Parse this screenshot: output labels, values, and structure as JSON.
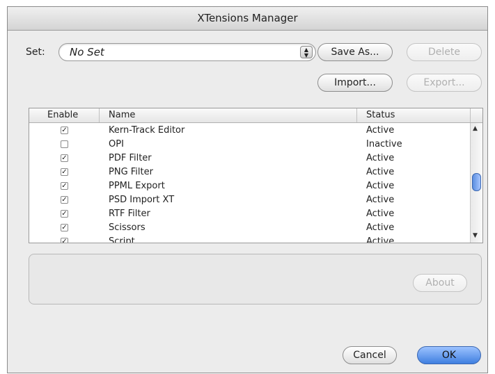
{
  "window": {
    "title": "XTensions Manager"
  },
  "set": {
    "label": "Set:",
    "value": "No Set"
  },
  "buttons": {
    "save_as": "Save As...",
    "delete": "Delete",
    "import": "Import...",
    "export": "Export...",
    "about": "About",
    "cancel": "Cancel",
    "ok": "OK"
  },
  "table": {
    "columns": [
      "Enable",
      "Name",
      "Status"
    ],
    "rows": [
      {
        "enabled": true,
        "name": "Kern-Track Editor",
        "status": "Active"
      },
      {
        "enabled": false,
        "name": "OPI",
        "status": "Inactive"
      },
      {
        "enabled": true,
        "name": "PDF Filter",
        "status": "Active"
      },
      {
        "enabled": true,
        "name": "PNG Filter",
        "status": "Active"
      },
      {
        "enabled": true,
        "name": "PPML Export",
        "status": "Active"
      },
      {
        "enabled": true,
        "name": "PSD Import XT",
        "status": "Active"
      },
      {
        "enabled": true,
        "name": "RTF Filter",
        "status": "Active"
      },
      {
        "enabled": true,
        "name": "Scissors",
        "status": "Active"
      },
      {
        "enabled": true,
        "name": "Script",
        "status": "Active"
      }
    ]
  },
  "icons": {
    "checked": "checkmark-icon",
    "popup_arrows": "updown-arrows-icon"
  }
}
